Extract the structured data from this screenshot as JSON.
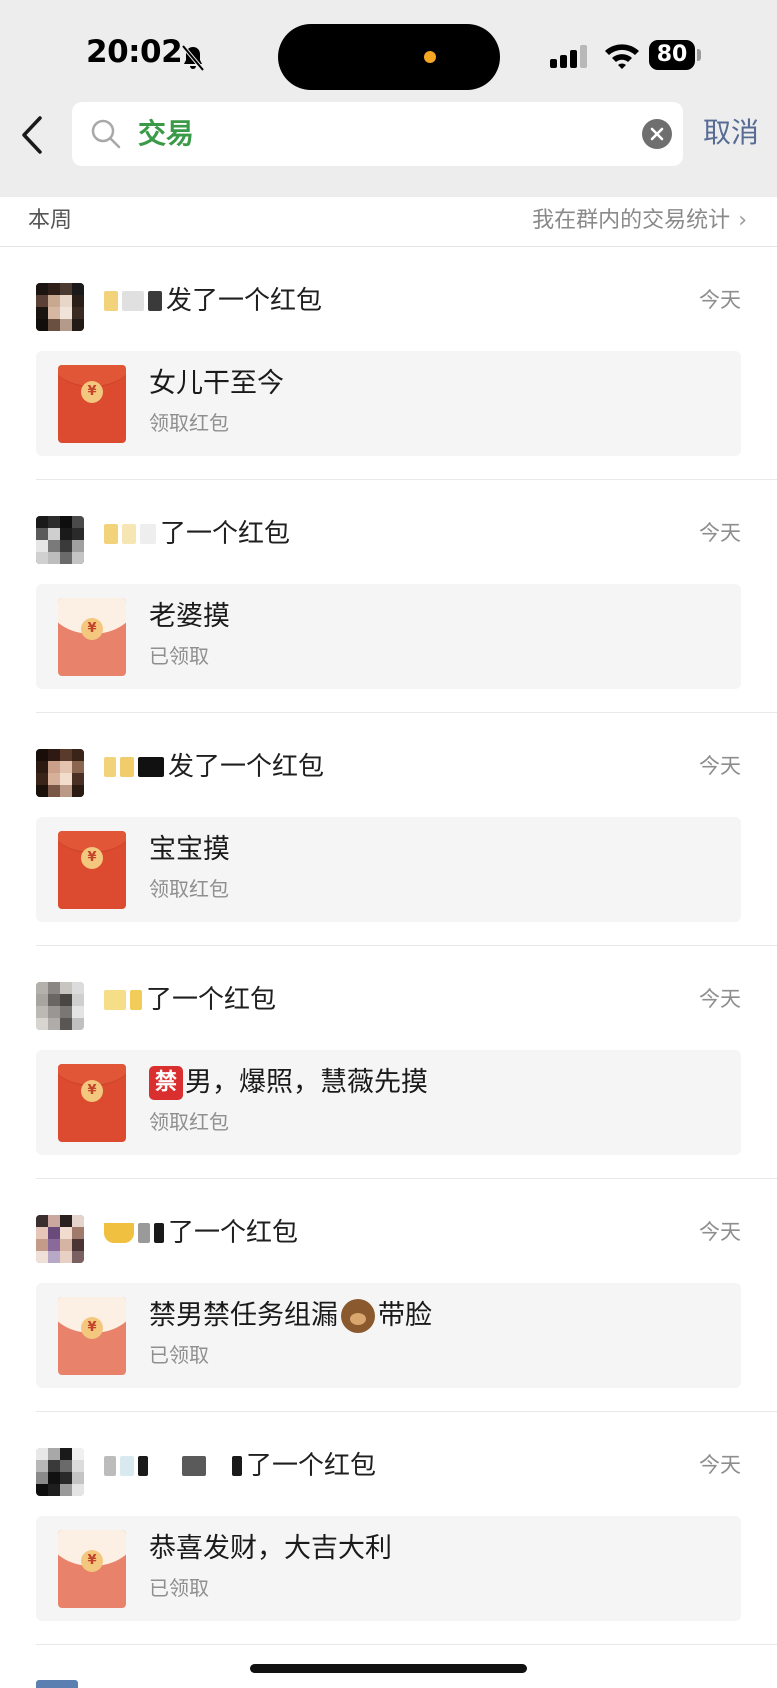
{
  "status_bar": {
    "time": "20:02",
    "battery": "80"
  },
  "search": {
    "query": "交易",
    "cancel_label": "取消"
  },
  "section": {
    "label": "本周",
    "stats_link": "我在群内的交易统计"
  },
  "items": [
    {
      "sender_suffix": "发了一个红包",
      "time": "今天",
      "title": "女儿干至今",
      "status": "领取红包",
      "opened": false
    },
    {
      "sender_suffix": "了一个红包",
      "time": "今天",
      "title": "老婆摸",
      "status": "已领取",
      "opened": true
    },
    {
      "sender_suffix": "发了一个红包",
      "time": "今天",
      "title": "宝宝摸",
      "status": "领取红包",
      "opened": false
    },
    {
      "sender_suffix": "了一个红包",
      "time": "今天",
      "title_badge": "禁",
      "title": "男，爆照，慧薇先摸",
      "status": "领取红包",
      "opened": false
    },
    {
      "sender_suffix": "了一个红包",
      "time": "今天",
      "title": "禁男禁任务组漏",
      "title_after_emoji": "带脸",
      "status": "已领取",
      "opened": true
    },
    {
      "sender_suffix": "了一个红包",
      "time": "今天",
      "title": "恭喜发财，大吉大利",
      "status": "已领取",
      "opened": true
    }
  ],
  "colors": {
    "accent_green": "#3b9a47",
    "link_blue": "#576b95",
    "packet_red": "#dc4a2f",
    "packet_opened": "#e8826b"
  }
}
